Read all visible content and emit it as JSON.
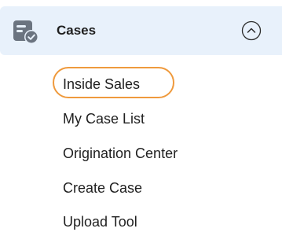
{
  "section": {
    "title": "Cases",
    "icon": "cases-icon",
    "collapse_icon": "chevron-up-circle-icon",
    "expanded": true
  },
  "items": [
    {
      "label": "Inside Sales",
      "highlighted": true
    },
    {
      "label": "My Case List"
    },
    {
      "label": "Origination Center"
    },
    {
      "label": "Create Case"
    },
    {
      "label": "Upload Tool"
    }
  ],
  "colors": {
    "header_bg": "#e8f1fb",
    "highlight": "#ef9a3d",
    "text": "#1f1f1f",
    "icon": "#6b7480"
  }
}
